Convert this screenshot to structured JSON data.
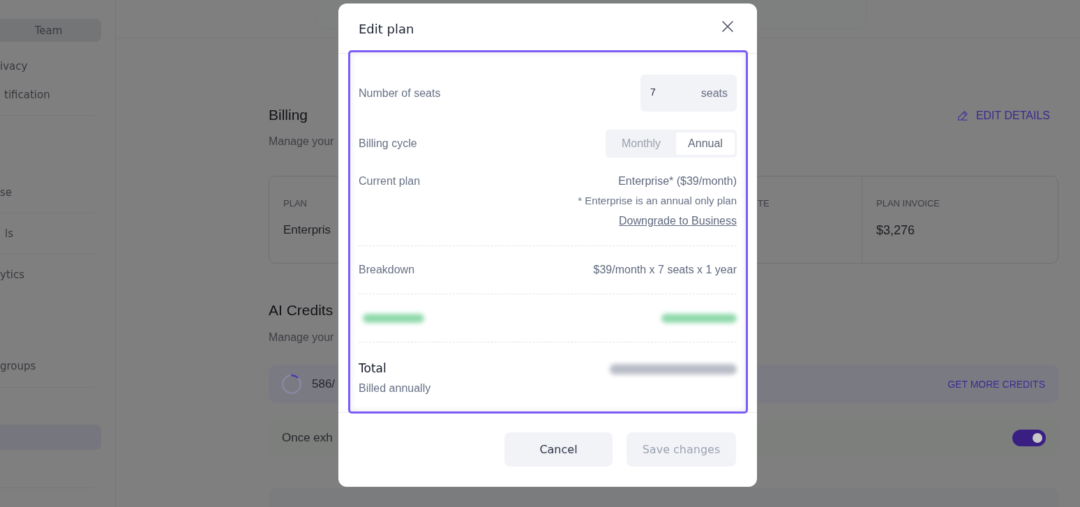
{
  "sidebar": {
    "team_button": "Team",
    "sections": [
      {
        "items": [
          {
            "label": "ivacy",
            "selected": false
          },
          {
            "label": "tification",
            "selected": false
          }
        ]
      },
      {
        "items": [
          {
            "label": "se",
            "selected": false
          }
        ]
      },
      {
        "items": [
          {
            "label": "ls",
            "selected": false
          }
        ]
      },
      {
        "items": [
          {
            "label": "ytics",
            "selected": false
          },
          {
            "label": "groups",
            "selected": false
          }
        ]
      },
      {
        "items": [
          {
            "selected": true
          }
        ]
      }
    ]
  },
  "main": {
    "billing": {
      "title": "Billing",
      "subtitle": "Manage your",
      "edit_button": "EDIT DETAILS"
    },
    "plan_card": {
      "columns": [
        {
          "label": "PLAN",
          "value": "Enterpris"
        },
        {},
        {
          "label": "TE"
        },
        {
          "label": "PLAN INVOICE",
          "value": "$3,276"
        }
      ]
    },
    "ai_credits": {
      "title": "AI Credits",
      "subtitle": "Manage your",
      "usage": "586/",
      "more_button": "GET MORE CREDITS",
      "auto_reload": {
        "text": "Once exh",
        "on": true
      }
    }
  },
  "modal": {
    "title": "Edit plan",
    "rows": [
      {
        "kind": "seats",
        "label": "Number of seats",
        "value": "7",
        "suffix": "seats"
      },
      {
        "kind": "cycle",
        "label": "Billing cycle",
        "options": [
          {
            "label": "Monthly",
            "selected": false
          },
          {
            "label": "Annual",
            "selected": true
          }
        ]
      },
      {
        "kind": "plan",
        "label": "Current plan",
        "value": "Enterprise* ($39/month)",
        "note": "* Enterprise is an annual only plan",
        "link": "Downgrade to Business"
      },
      {
        "kind": "breakdown",
        "label": "Breakdown",
        "value": "$39/month x 7 seats x 1 year"
      },
      {
        "kind": "redacted"
      },
      {
        "kind": "total",
        "label": "Total",
        "sublabel": "Billed annually",
        "amount_redacted": true
      }
    ],
    "buttons": [
      {
        "label": "Cancel",
        "disabled": false
      },
      {
        "label": "Save changes",
        "disabled": true
      }
    ]
  }
}
